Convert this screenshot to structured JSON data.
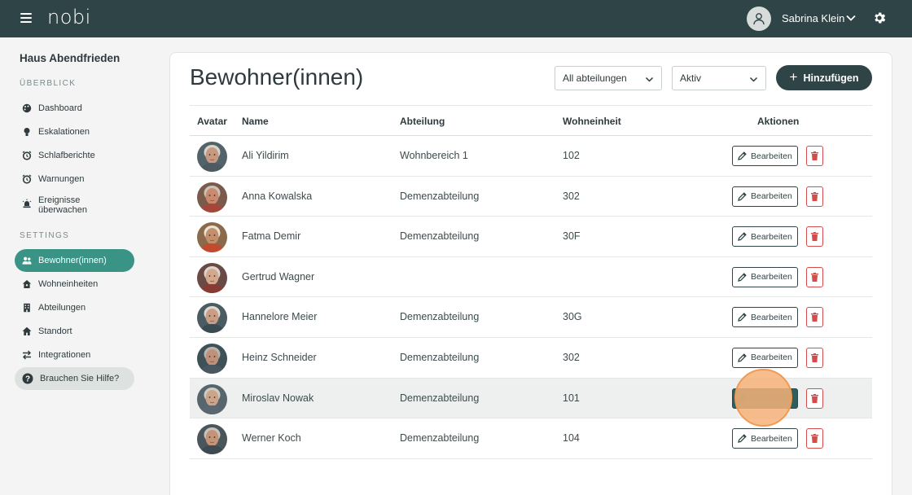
{
  "app": {
    "logo": "nobi"
  },
  "topbar": {
    "menu_icon": "hamburger-icon",
    "user_name": "Sabrina Klein",
    "settings_icon": "gear-icon"
  },
  "sidebar": {
    "org_name": "Haus Abendfrieden",
    "section_overview": "ÜBERBLICK",
    "section_settings": "SETTINGS",
    "overview_items": [
      {
        "label": "Dashboard",
        "icon": "palette-icon"
      },
      {
        "label": "Eskalationen",
        "icon": "lightbulb-icon"
      },
      {
        "label": "Schlafberichte",
        "icon": "alarm-clock-icon"
      },
      {
        "label": "Warnungen",
        "icon": "alarm-clock-icon"
      },
      {
        "label": "Ereignisse überwachen",
        "icon": "siren-icon"
      }
    ],
    "settings_items": [
      {
        "label": "Bewohner(innen)",
        "icon": "people-icon",
        "active": true
      },
      {
        "label": "Wohneinheiten",
        "icon": "house-icon"
      },
      {
        "label": "Abteilungen",
        "icon": "building-icon"
      },
      {
        "label": "Standort",
        "icon": "home-icon"
      },
      {
        "label": "Integrationen",
        "icon": "swap-arrows-icon"
      }
    ],
    "help_label": "Brauchen Sie Hilfe?"
  },
  "main": {
    "title": "Bewohner(innen)",
    "filter_department": "All abteilungen",
    "filter_status": "Aktiv",
    "add_button": "Hinzufügen"
  },
  "table": {
    "headers": {
      "avatar": "Avatar",
      "name": "Name",
      "department": "Abteilung",
      "unit": "Wohneinheit",
      "actions": "Aktionen"
    },
    "edit_label": "Bearbeiten",
    "rows": [
      {
        "name": "Ali Yildirim",
        "department": "Wohnbereich 1",
        "unit": "102"
      },
      {
        "name": "Anna Kowalska",
        "department": "Demenzabteilung",
        "unit": "302"
      },
      {
        "name": "Fatma Demir",
        "department": "Demenzabteilung",
        "unit": "30F"
      },
      {
        "name": "Gertrud Wagner",
        "department": "",
        "unit": ""
      },
      {
        "name": "Hannelore Meier",
        "department": "Demenzabteilung",
        "unit": "30G"
      },
      {
        "name": "Heinz Schneider",
        "department": "Demenzabteilung",
        "unit": "302"
      },
      {
        "name": "Miroslav Nowak",
        "department": "Demenzabteilung",
        "unit": "101"
      },
      {
        "name": "Werner Koch",
        "department": "Demenzabteilung",
        "unit": "104"
      }
    ]
  }
}
